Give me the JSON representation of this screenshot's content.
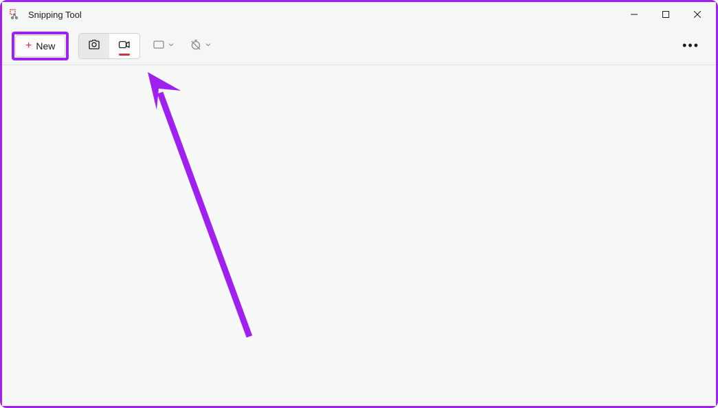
{
  "window": {
    "title": "Snipping Tool"
  },
  "toolbar": {
    "new_label": "New"
  },
  "colors": {
    "highlight": "#a020f0",
    "accent_red": "#d13438"
  }
}
